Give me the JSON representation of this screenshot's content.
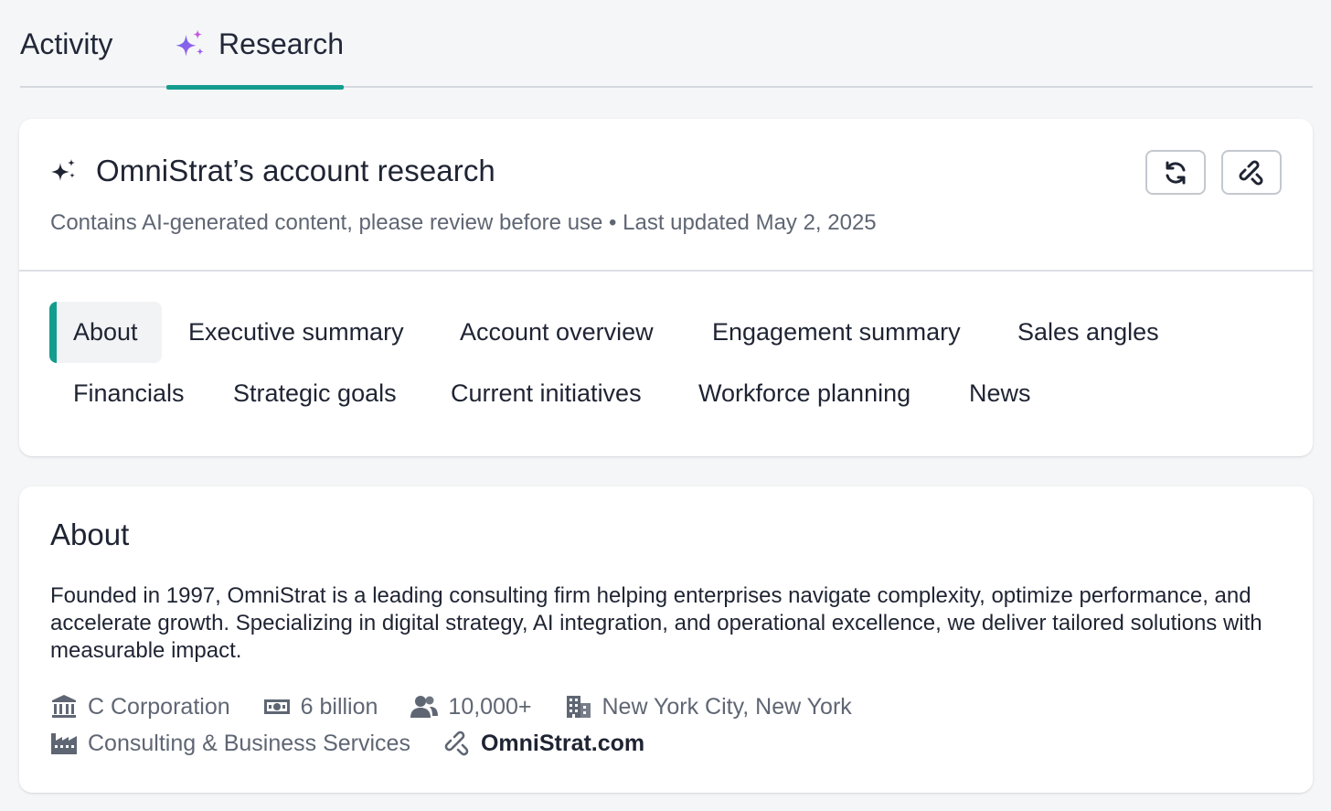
{
  "top_tabs": {
    "activity": "Activity",
    "research": "Research"
  },
  "colors": {
    "accent": "#139d8f",
    "sparkle_purple": "#8a5cf6",
    "sparkle_blue": "#5b6cf0",
    "text_primary": "#1f2433",
    "text_muted": "#5f6673"
  },
  "research_card": {
    "title": "OmniStrat’s account research",
    "subtitle": "Contains AI-generated content, please review before use • Last updated May 2, 2025",
    "refresh_icon": "refresh-icon",
    "link_icon": "link-icon"
  },
  "sections": [
    "About",
    "Executive summary",
    "Account overview",
    "Engagement summary",
    "Sales angles",
    "Financials",
    "Strategic goals",
    "Current initiatives",
    "Workforce planning",
    "News"
  ],
  "about": {
    "heading": "About",
    "description": "Founded in 1997, OmniStrat is a leading consulting firm helping enterprises navigate complexity, optimize performance, and accelerate growth. Specializing in digital strategy, AI integration, and operational excellence, we deliver tailored solutions with measurable impact.",
    "entity_type": "C Corporation",
    "revenue": "6 billion",
    "employees": "10,000+",
    "location": "New York City, New York",
    "industry": "Consulting & Business Services",
    "website": "OmniStrat.com"
  }
}
